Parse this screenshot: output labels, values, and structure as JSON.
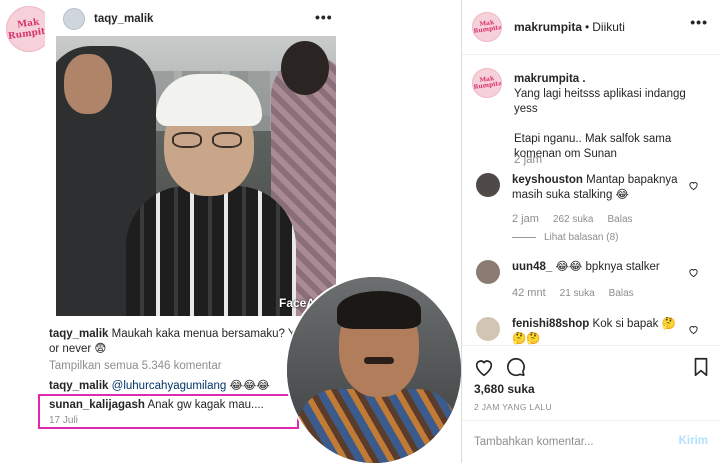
{
  "media": {
    "logo_text": "Mak Rumpita",
    "post": {
      "username": "taqy_malik",
      "watermark": "FaceAr",
      "caption_user": "taqy_malik",
      "caption_text": "Maukah kaka menua bersamaku? Yes or never 😨",
      "view_all": "Tampilkan semua 5.346 komentar",
      "comment2_user": "taqy_malik",
      "comment2_mention": "@luhurcahyagumilang",
      "comment2_emoji": "😂😂😂",
      "comment3_user": "sunan_kalijagash",
      "comment3_text": "Anak gw kagak mau....",
      "date": "17 Juli"
    }
  },
  "side": {
    "header": {
      "username": "makrumpita",
      "separator": "•",
      "follow_status": "Diikuti"
    },
    "caption": {
      "username": "makrumpita .",
      "line1": "Yang lagi heitsss aplikasi indangg yess",
      "line2": "Etapi nganu.. Mak salfok sama komenan om Sunan",
      "time": "2 jam"
    },
    "comments": [
      {
        "user": "keyshouston",
        "text": "Mantap bapaknya masih suka stalking 😂",
        "time": "2 jam",
        "likes": "262 suka",
        "reply": "Balas",
        "avatar_color": "#4f4a47"
      },
      {
        "user": "uun48_",
        "text": "😂😂 bpknya stalker",
        "time": "42 mnt",
        "likes": "21 suka",
        "reply": "Balas",
        "avatar_color": "#8b7b73"
      },
      {
        "user": "fenishi88shop",
        "text": "Kok si bapak 🤔🤔🤔",
        "avatar_color": "#d2c5b3"
      }
    ],
    "view_replies": "Lihat balasan (8)",
    "likes": "3,680 suka",
    "ago": "2 JAM YANG LALU",
    "comment_placeholder": "Tambahkan komentar...",
    "send_label": "Kirim"
  },
  "colors": {
    "highlight_box": "#e029b3",
    "brand_pink": "#d6336c",
    "muted": "#8e8e8e",
    "send_disabled": "#b2dffc"
  }
}
